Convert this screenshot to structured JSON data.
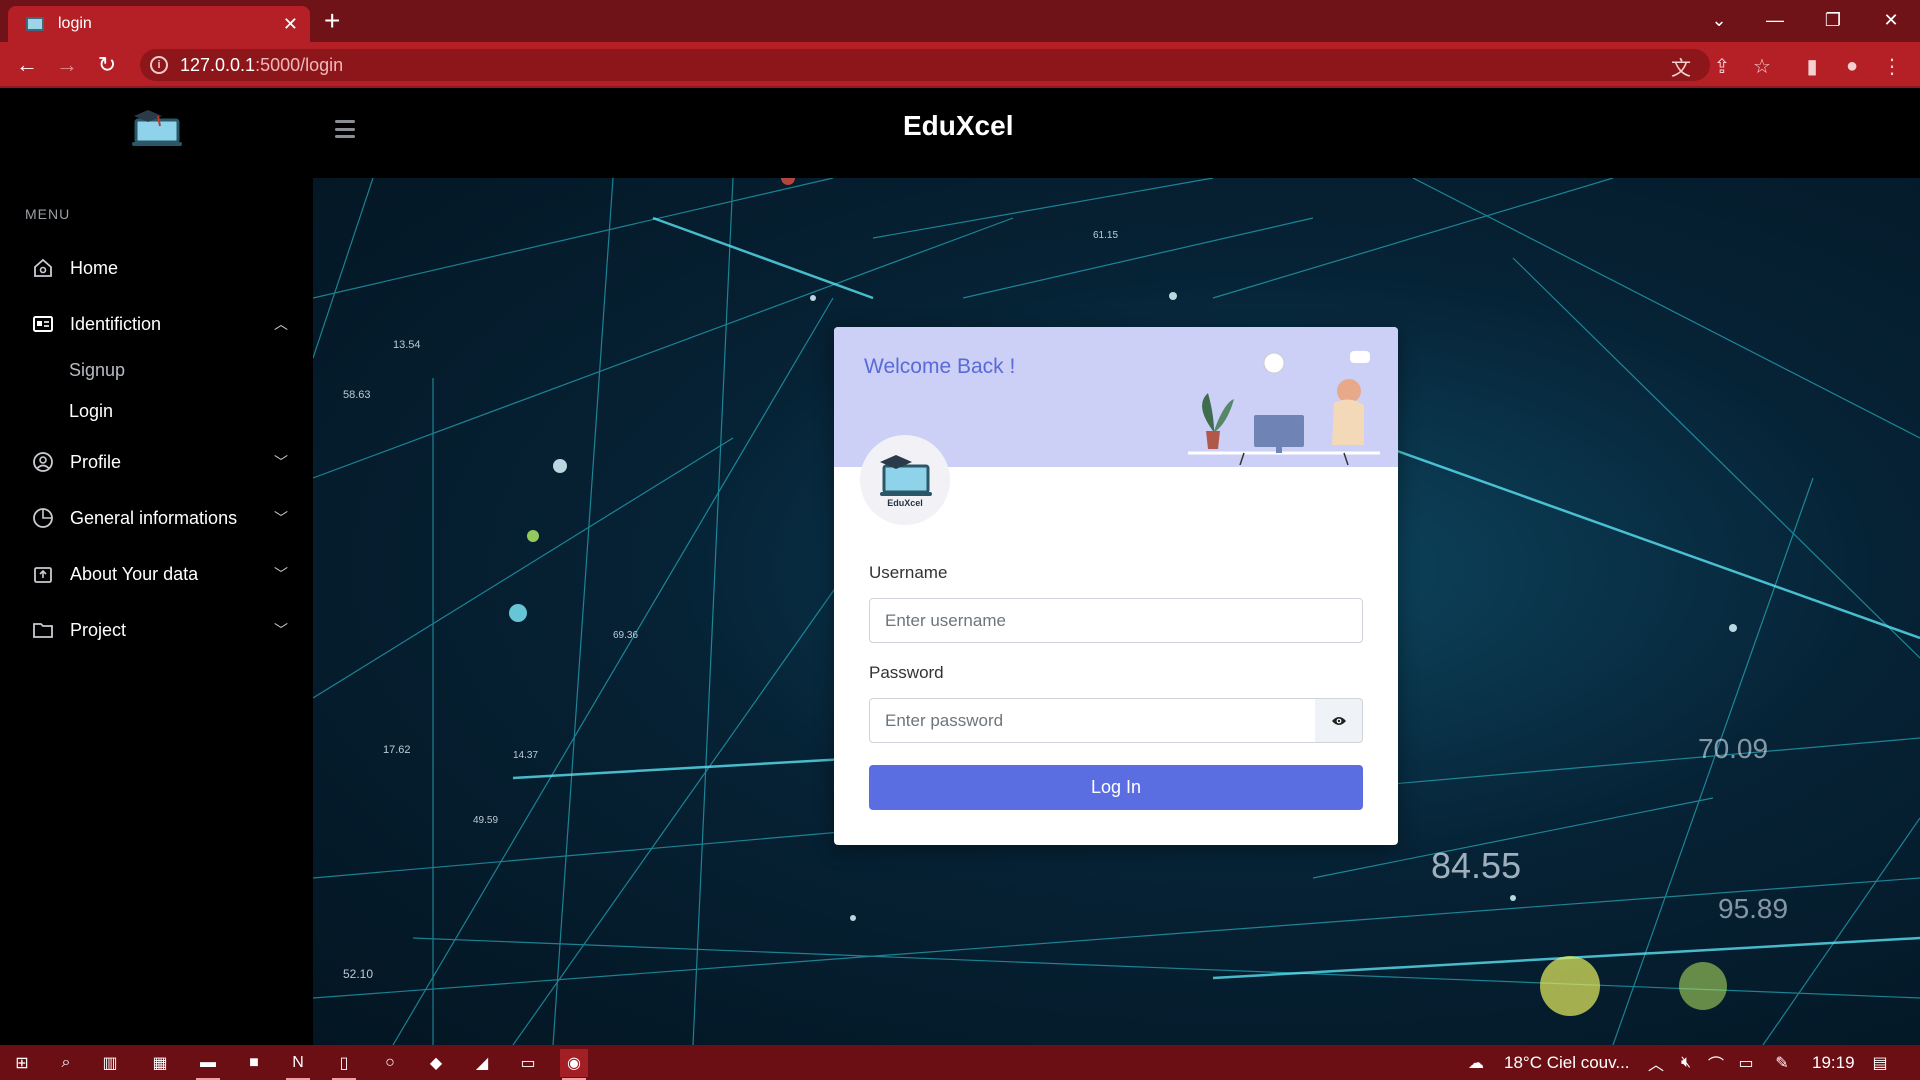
{
  "browser": {
    "tab_title": "login",
    "url_host": "127.0.0.1",
    "url_path": ":5000/login"
  },
  "app": {
    "brand": "EduXcel",
    "logo_text": "EduXcel"
  },
  "sidebar": {
    "menu_heading": "MENU",
    "items": [
      {
        "label": "Home",
        "icon": "home-icon"
      },
      {
        "label": "Identifiction",
        "icon": "id-card-icon",
        "expanded": true
      },
      {
        "label": "Profile",
        "icon": "user-circle-icon"
      },
      {
        "label": "General informations",
        "icon": "pie-chart-icon"
      },
      {
        "label": "About Your data",
        "icon": "upload-box-icon"
      },
      {
        "label": "Project",
        "icon": "folder-icon"
      }
    ],
    "subitems": [
      {
        "label": "Signup",
        "active": false
      },
      {
        "label": "Login",
        "active": true
      }
    ]
  },
  "login": {
    "welcome": "Welcome Back !",
    "username_label": "Username",
    "username_placeholder": "Enter username",
    "password_label": "Password",
    "password_placeholder": "Enter password",
    "submit_label": "Log In"
  },
  "taskbar": {
    "weather": "18°C  Ciel couv...",
    "time": "19:19"
  },
  "colors": {
    "browser_accent": "#b52027",
    "card_header": "#ccd0f7",
    "primary_button": "#5b6ee1",
    "welcome_text": "#5a6ad6"
  }
}
